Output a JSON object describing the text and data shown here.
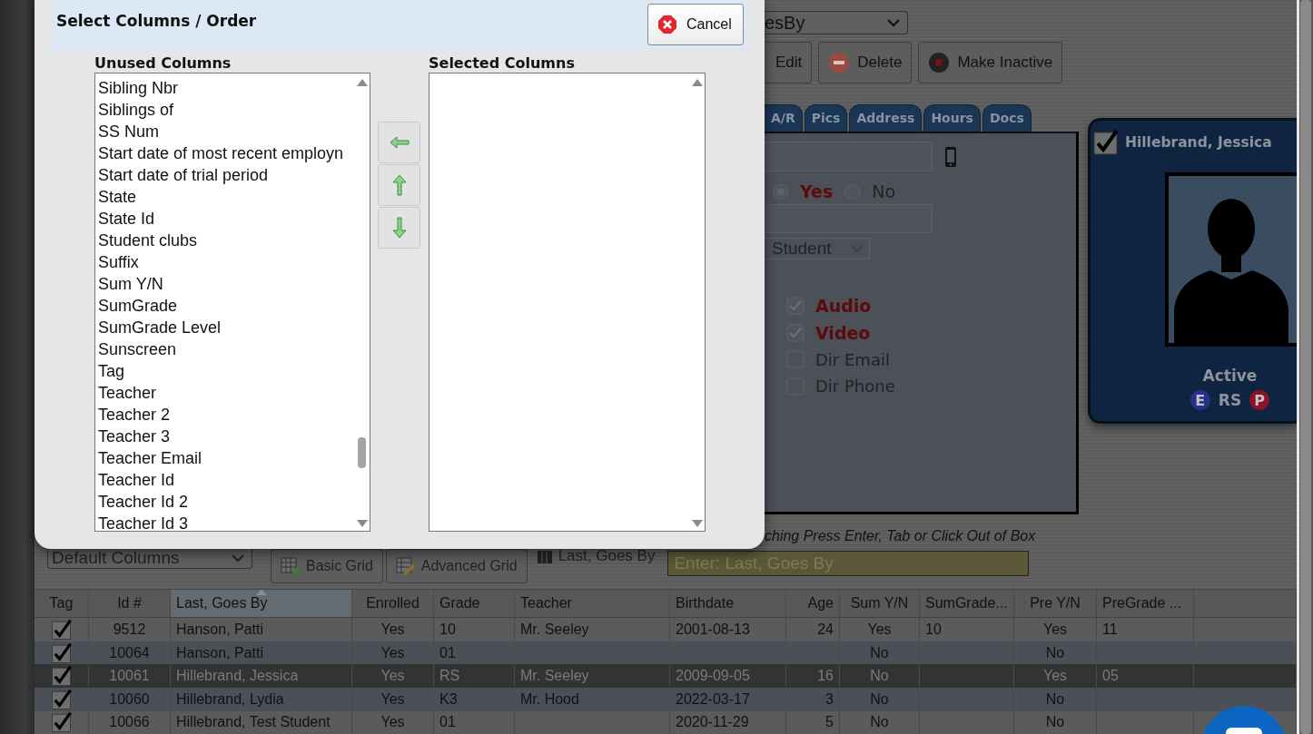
{
  "dialog": {
    "title": "Select Columns / Order",
    "cancel_button": "Cancel",
    "unused_columns": {
      "label": "Unused Columns",
      "items": [
        "Sibling Nbr",
        "Siblings of",
        "SS Num",
        "Start date of most recent employn",
        "Start date of trial period",
        "State",
        "State Id",
        "Student clubs",
        "Suffix",
        "Sum Y/N",
        "SumGrade",
        "SumGrade Level",
        "Sunscreen",
        "Tag",
        "Teacher",
        "Teacher 2",
        "Teacher 3",
        "Teacher Email",
        "Teacher Id",
        "Teacher Id 2",
        "Teacher Id 3"
      ]
    },
    "selected_columns": {
      "label": "Selected Columns"
    }
  },
  "toolbar": {
    "sort_select": "esBy",
    "buttons": [
      "Edit",
      "Delete",
      "Make Inactive"
    ]
  },
  "tabs": [
    "A/R",
    "Pics",
    "Address",
    "Hours",
    "Docs"
  ],
  "form": {
    "radio_options": [
      {
        "label": "Yes",
        "selected": true
      },
      {
        "label": "No",
        "selected": false
      }
    ],
    "type_select": "Student",
    "checkboxes": [
      {
        "label": "Audio",
        "checked": true
      },
      {
        "label": "Video",
        "checked": true
      },
      {
        "label": "Dir Email",
        "checked": false
      },
      {
        "label": "Dir Phone",
        "checked": false
      }
    ]
  },
  "card": {
    "tagged": true,
    "name": "Hillebrand, Jessica",
    "status": "Active",
    "badges": [
      {
        "label": "E",
        "kind": "round",
        "color": "#2b2f8c"
      },
      {
        "label": "RS",
        "kind": "plain"
      },
      {
        "label": "P",
        "kind": "round",
        "color": "#8c1228"
      }
    ]
  },
  "search": {
    "hint": "ching Press Enter, Tab or Click Out of Box",
    "placeholder": "Enter: Last, Goes By"
  },
  "grid_controls": {
    "column_set": "Default Columns",
    "buttons": [
      "Basic Grid",
      "Advanced Grid"
    ],
    "sort_checkbox": "Last, Goes By"
  },
  "grid": {
    "columns": [
      "Tag",
      "Id #",
      "Last, Goes By",
      "Enrolled",
      "Grade",
      "Teacher",
      "Birthdate",
      "Age",
      "Sum Y/N",
      "SumGrade...",
      "Pre Y/N",
      "PreGrade ..."
    ],
    "rows": [
      {
        "tagged": true,
        "selected": false,
        "cells": [
          null,
          "9512",
          "Hanson, Patti",
          "Yes",
          "10",
          "Mr. Seeley",
          "2001-08-13",
          "24",
          "Yes",
          "10",
          "Yes",
          "11"
        ]
      },
      {
        "tagged": true,
        "selected": false,
        "cells": [
          null,
          "10064",
          "Hanson, Patti",
          "Yes",
          "01",
          null,
          null,
          null,
          "No",
          null,
          "No",
          null
        ]
      },
      {
        "tagged": true,
        "selected": true,
        "cells": [
          null,
          "10061",
          "Hillebrand, Jessica",
          "Yes",
          "RS",
          "Mr. Seeley",
          "2009-09-05",
          "16",
          "No",
          null,
          "Yes",
          "05"
        ]
      },
      {
        "tagged": true,
        "selected": false,
        "cells": [
          null,
          "10060",
          "Hillebrand, Lydia",
          "Yes",
          "K3",
          "Mr. Hood",
          "2022-03-17",
          "3",
          "No",
          null,
          "No",
          null
        ]
      },
      {
        "tagged": true,
        "selected": false,
        "cells": [
          null,
          "10066",
          "Hillebrand, Test Student",
          "Yes",
          "01",
          null,
          "2020-11-29",
          "5",
          "No",
          null,
          "No",
          null
        ]
      }
    ]
  }
}
